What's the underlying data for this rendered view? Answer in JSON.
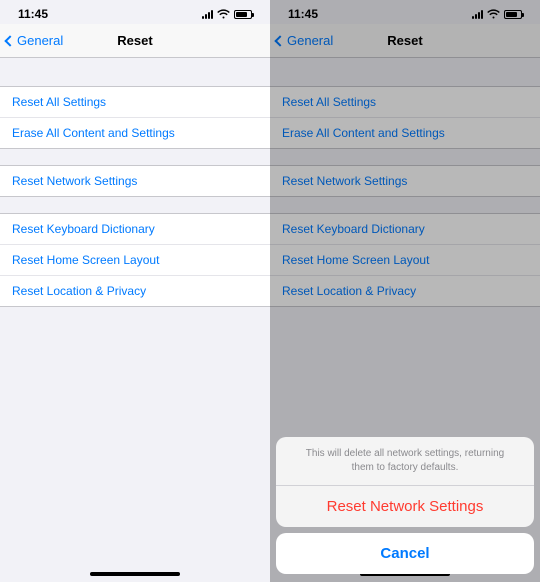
{
  "left": {
    "status": {
      "time": "11:45"
    },
    "nav": {
      "back": "General",
      "title": "Reset"
    },
    "group1": {
      "items": [
        {
          "label": "Reset All Settings"
        },
        {
          "label": "Erase All Content and Settings"
        }
      ]
    },
    "group2": {
      "items": [
        {
          "label": "Reset Network Settings"
        }
      ]
    },
    "group3": {
      "items": [
        {
          "label": "Reset Keyboard Dictionary"
        },
        {
          "label": "Reset Home Screen Layout"
        },
        {
          "label": "Reset Location & Privacy"
        }
      ]
    }
  },
  "right": {
    "status": {
      "time": "11:45"
    },
    "nav": {
      "back": "General",
      "title": "Reset"
    },
    "group1": {
      "items": [
        {
          "label": "Reset All Settings"
        },
        {
          "label": "Erase All Content and Settings"
        }
      ]
    },
    "group2": {
      "items": [
        {
          "label": "Reset Network Settings"
        }
      ]
    },
    "group3": {
      "items": [
        {
          "label": "Reset Keyboard Dictionary"
        },
        {
          "label": "Reset Home Screen Layout"
        },
        {
          "label": "Reset Location & Privacy"
        }
      ]
    },
    "sheet": {
      "message": "This will delete all network settings, returning them to factory defaults.",
      "action": "Reset Network Settings",
      "cancel": "Cancel"
    }
  }
}
